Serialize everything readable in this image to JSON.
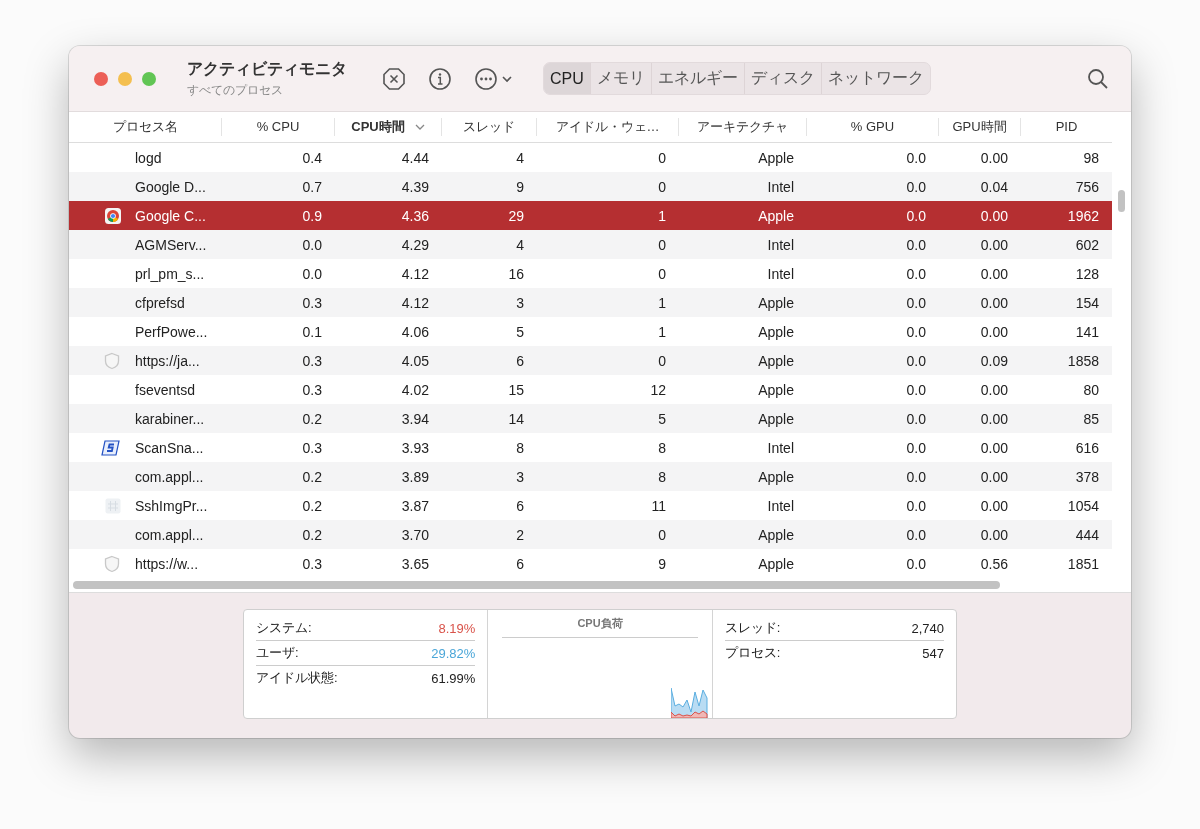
{
  "window": {
    "title": "アクティビティモニタ",
    "subtitle": "すべてのプロセス"
  },
  "tabs": [
    {
      "label": "CPU",
      "selected": true
    },
    {
      "label": "メモリ",
      "selected": false
    },
    {
      "label": "エネルギー",
      "selected": false
    },
    {
      "label": "ディスク",
      "selected": false
    },
    {
      "label": "ネットワーク",
      "selected": false
    }
  ],
  "table": {
    "columns": [
      {
        "label": "プロセス名",
        "sorted": false
      },
      {
        "label": "% CPU",
        "sorted": false
      },
      {
        "label": "CPU時間",
        "sorted": true
      },
      {
        "label": "スレッド",
        "sorted": false
      },
      {
        "label": "アイドル・ウェ…",
        "sorted": false
      },
      {
        "label": "アーキテクチャ",
        "sorted": false
      },
      {
        "label": "% GPU",
        "sorted": false
      },
      {
        "label": "GPU時間",
        "sorted": false
      },
      {
        "label": "PID",
        "sorted": false
      }
    ],
    "rows": [
      {
        "kind": "plain",
        "selected": false,
        "cells": [
          "logd",
          "0.4",
          "4.44",
          "4",
          "0",
          "Apple",
          "0.0",
          "0.00",
          "98"
        ]
      },
      {
        "kind": "plain",
        "selected": false,
        "cells": [
          "Google D...",
          "0.7",
          "4.39",
          "9",
          "0",
          "Intel",
          "0.0",
          "0.04",
          "756"
        ]
      },
      {
        "kind": "browser",
        "selected": true,
        "cells": [
          "Google C...",
          "0.9",
          "4.36",
          "29",
          "1",
          "Apple",
          "0.0",
          "0.00",
          "1962"
        ]
      },
      {
        "kind": "plain",
        "selected": false,
        "cells": [
          "AGMServ...",
          "0.0",
          "4.29",
          "4",
          "0",
          "Intel",
          "0.0",
          "0.00",
          "602"
        ]
      },
      {
        "kind": "plain",
        "selected": false,
        "cells": [
          "prl_pm_s...",
          "0.0",
          "4.12",
          "16",
          "0",
          "Intel",
          "0.0",
          "0.00",
          "128"
        ]
      },
      {
        "kind": "plain",
        "selected": false,
        "cells": [
          "cfprefsd",
          "0.3",
          "4.12",
          "3",
          "1",
          "Apple",
          "0.0",
          "0.00",
          "154"
        ]
      },
      {
        "kind": "plain",
        "selected": false,
        "cells": [
          "PerfPowe...",
          "0.1",
          "4.06",
          "5",
          "1",
          "Apple",
          "0.0",
          "0.00",
          "141"
        ]
      },
      {
        "kind": "web",
        "selected": false,
        "cells": [
          "https://ja...",
          "0.3",
          "4.05",
          "6",
          "0",
          "Apple",
          "0.0",
          "0.09",
          "1858"
        ]
      },
      {
        "kind": "plain",
        "selected": false,
        "cells": [
          "fseventsd",
          "0.3",
          "4.02",
          "15",
          "12",
          "Apple",
          "0.0",
          "0.00",
          "80"
        ]
      },
      {
        "kind": "plain",
        "selected": false,
        "cells": [
          "karabiner...",
          "0.2",
          "3.94",
          "14",
          "5",
          "Apple",
          "0.0",
          "0.00",
          "85"
        ]
      },
      {
        "kind": "scanner",
        "selected": false,
        "cells": [
          "ScanSna...",
          "0.3",
          "3.93",
          "8",
          "8",
          "Intel",
          "0.0",
          "0.00",
          "616"
        ]
      },
      {
        "kind": "plain",
        "selected": false,
        "cells": [
          "com.appl...",
          "0.2",
          "3.89",
          "3",
          "8",
          "Apple",
          "0.0",
          "0.00",
          "378"
        ]
      },
      {
        "kind": "utility",
        "selected": false,
        "cells": [
          "SshImgPr...",
          "0.2",
          "3.87",
          "6",
          "11",
          "Intel",
          "0.0",
          "0.00",
          "1054"
        ]
      },
      {
        "kind": "plain",
        "selected": false,
        "cells": [
          "com.appl...",
          "0.2",
          "3.70",
          "2",
          "0",
          "Apple",
          "0.0",
          "0.00",
          "444"
        ]
      },
      {
        "kind": "web",
        "selected": false,
        "cells": [
          "https://w...",
          "0.3",
          "3.65",
          "6",
          "9",
          "Apple",
          "0.0",
          "0.56",
          "1851"
        ]
      }
    ]
  },
  "summary": {
    "load_stats": [
      {
        "label": "システム:",
        "value": "8.19%",
        "color": "#d9534a"
      },
      {
        "label": "ユーザ:",
        "value": "29.82%",
        "color": "#4aa6d8"
      },
      {
        "label": "アイドル状態:",
        "value": "61.99%",
        "color": "#222222"
      }
    ],
    "chart_title": "CPU負荷",
    "counts": [
      {
        "label": "スレッド:",
        "value": "2,740"
      },
      {
        "label": "プロセス:",
        "value": "547"
      }
    ]
  }
}
